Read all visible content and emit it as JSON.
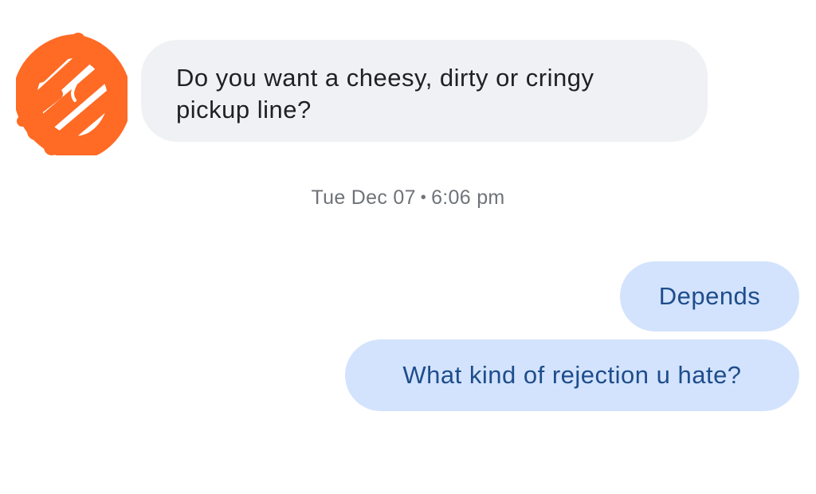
{
  "conversation": {
    "incoming": {
      "line1": "Do you want a cheesy, dirty or cringy",
      "line2": "pickup line?"
    },
    "timestamp": {
      "date": "Tue Dec 07",
      "separator": "•",
      "time": "6:06 pm"
    },
    "outgoing": [
      {
        "text": "Depends"
      },
      {
        "text": "What kind of rejection u hate?"
      }
    ]
  },
  "colors": {
    "avatar_scribble": "#ff6a24",
    "incoming_bubble": "#f0f1f4",
    "outgoing_bubble": "#d3e3fd",
    "outgoing_text": "#1e4d8c",
    "timestamp_text": "#6f7378"
  },
  "icons": {
    "avatar": "redacted-avatar-scribble"
  }
}
